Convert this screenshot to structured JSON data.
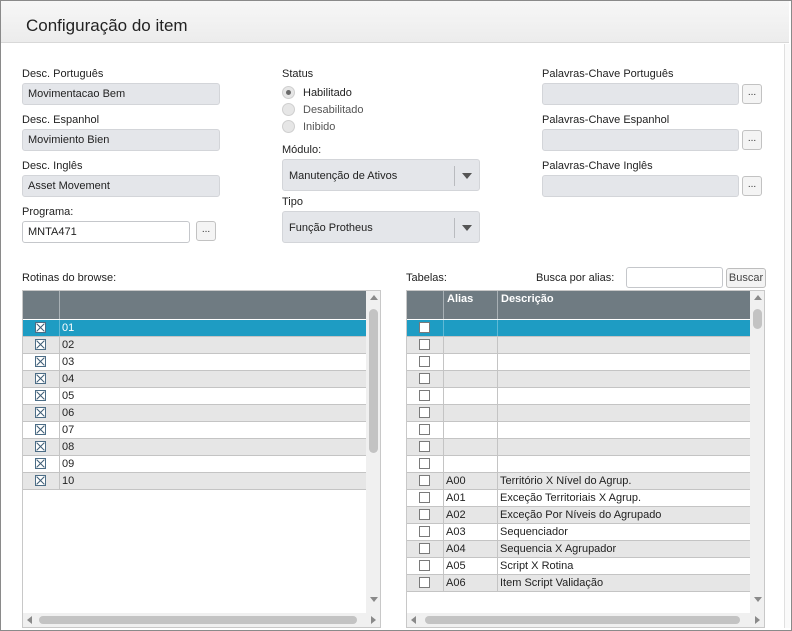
{
  "header": {
    "title": "Configuração do item"
  },
  "fields": {
    "desc_pt": {
      "label": "Desc. Português",
      "value": "Movimentacao Bem"
    },
    "desc_es": {
      "label": "Desc. Espanhol",
      "value": "Movimiento Bien"
    },
    "desc_en": {
      "label": "Desc. Inglês",
      "value": "Asset Movement"
    },
    "programa": {
      "label": "Programa:",
      "value": "MNTA471",
      "button": "..."
    }
  },
  "status": {
    "label": "Status",
    "options": [
      {
        "label": "Habilitado",
        "selected": true
      },
      {
        "label": "Desabilitado",
        "selected": false
      },
      {
        "label": "Inibido",
        "selected": false
      }
    ]
  },
  "modulo": {
    "label": "Módulo:",
    "value": "Manutenção de Ativos"
  },
  "tipo": {
    "label": "Tipo",
    "value": "Função Protheus"
  },
  "keywords": {
    "pt": {
      "label": "Palavras-Chave Português",
      "value": "",
      "button": "..."
    },
    "es": {
      "label": "Palavras-Chave Espanhol",
      "value": "",
      "button": "..."
    },
    "en": {
      "label": "Palavras-Chave Inglês",
      "value": "",
      "button": "..."
    }
  },
  "rotinas": {
    "label": "Rotinas do browse:",
    "rows": [
      {
        "checked": true,
        "value": "01",
        "selected": true
      },
      {
        "checked": true,
        "value": "02"
      },
      {
        "checked": true,
        "value": "03"
      },
      {
        "checked": true,
        "value": "04"
      },
      {
        "checked": true,
        "value": "05"
      },
      {
        "checked": true,
        "value": "06"
      },
      {
        "checked": true,
        "value": "07"
      },
      {
        "checked": true,
        "value": "08"
      },
      {
        "checked": true,
        "value": "09"
      },
      {
        "checked": true,
        "value": "10"
      }
    ]
  },
  "tabelas": {
    "label": "Tabelas:",
    "search_label": "Busca por alias:",
    "search_value": "",
    "search_button": "Buscar",
    "headers": {
      "alias": "Alias",
      "descricao": "Descrição"
    },
    "rows": [
      {
        "alias": "",
        "descricao": "",
        "selected": true
      },
      {
        "alias": "",
        "descricao": ""
      },
      {
        "alias": "",
        "descricao": ""
      },
      {
        "alias": "",
        "descricao": ""
      },
      {
        "alias": "",
        "descricao": ""
      },
      {
        "alias": "",
        "descricao": ""
      },
      {
        "alias": "",
        "descricao": ""
      },
      {
        "alias": "",
        "descricao": ""
      },
      {
        "alias": "",
        "descricao": ""
      },
      {
        "alias": "A00",
        "descricao": "Território X Nível do Agrup."
      },
      {
        "alias": "A01",
        "descricao": "Exceção Territoriais X Agrup."
      },
      {
        "alias": "A02",
        "descricao": "Exceção Por Níveis do Agrupado"
      },
      {
        "alias": "A03",
        "descricao": "Sequenciador"
      },
      {
        "alias": "A04",
        "descricao": "Sequencia X Agrupador"
      },
      {
        "alias": "A05",
        "descricao": "Script X Rotina"
      },
      {
        "alias": "A06",
        "descricao": "Item Script Validação"
      }
    ]
  }
}
